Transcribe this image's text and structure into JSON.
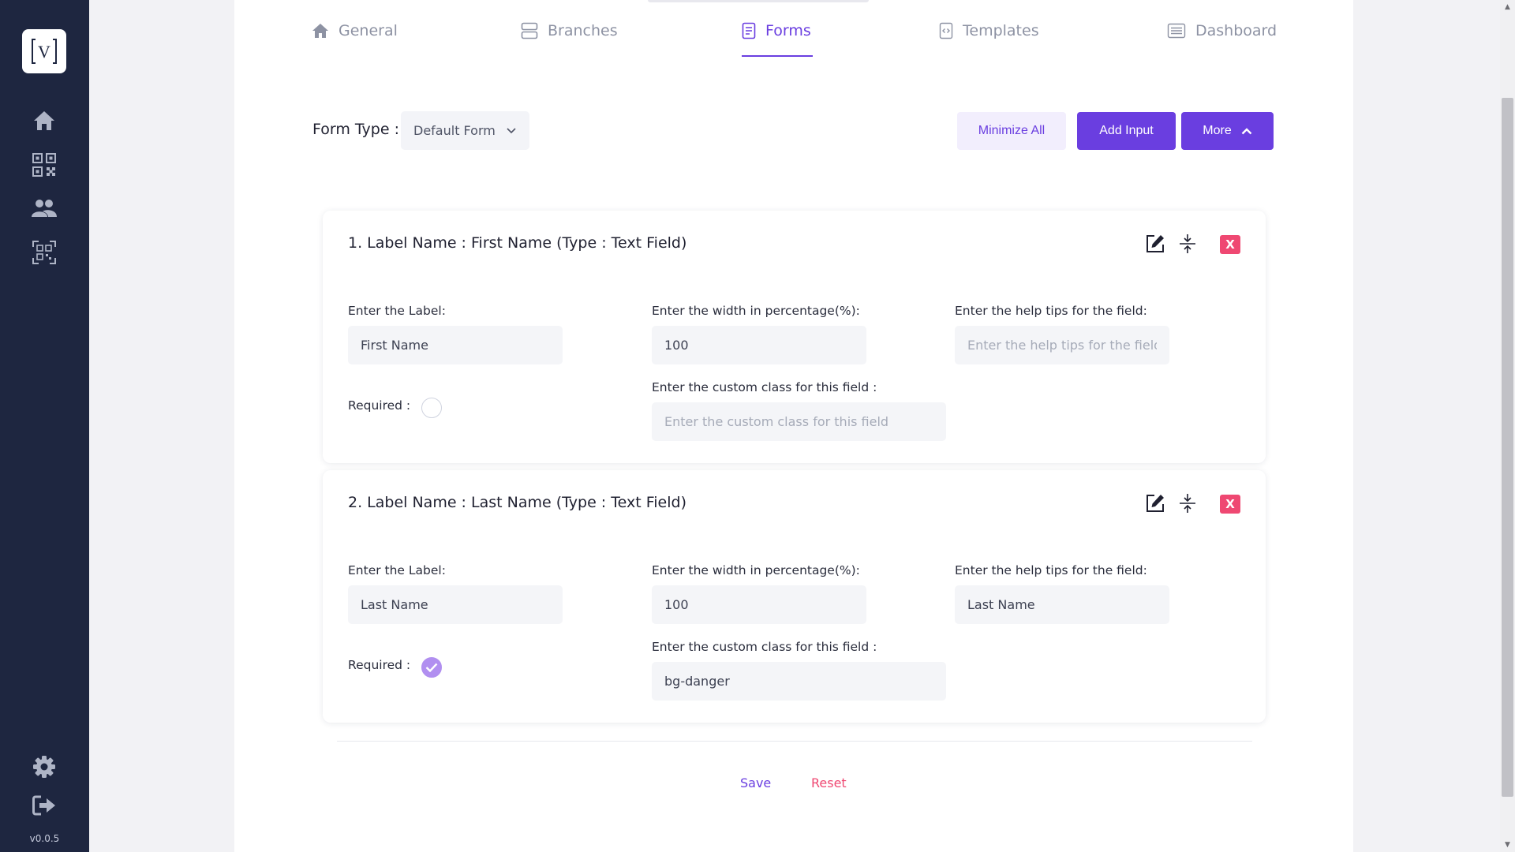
{
  "sidebar": {
    "logo_letter": "V",
    "version": "v0.0.5",
    "items": [
      {
        "name": "home-icon"
      },
      {
        "name": "qr-code-icon"
      },
      {
        "name": "users-icon"
      },
      {
        "name": "qr-scan-icon"
      }
    ],
    "bottom_items": [
      {
        "name": "settings-icon"
      },
      {
        "name": "logout-icon"
      }
    ]
  },
  "tabs": [
    {
      "label": "General",
      "icon": "home-icon",
      "active": false
    },
    {
      "label": "Branches",
      "icon": "branches-icon",
      "active": false
    },
    {
      "label": "Forms",
      "icon": "document-icon",
      "active": true
    },
    {
      "label": "Templates",
      "icon": "code-file-icon",
      "active": false
    },
    {
      "label": "Dashboard",
      "icon": "list-icon",
      "active": false
    }
  ],
  "toolbar": {
    "form_type_label": "Form Type :",
    "form_type_value": "Default Form",
    "minimize_all": "Minimize All",
    "add_input": "Add Input",
    "more": "More"
  },
  "fields": [
    {
      "title": "1. Label Name : First Name (Type : Text Field)",
      "label_caption": "Enter the Label:",
      "label_value": "First Name",
      "width_caption": "Enter the width in percentage(%):",
      "width_value": "100",
      "help_caption": "Enter the help tips for the field:",
      "help_value": "",
      "help_placeholder": "Enter the help tips for the field",
      "required_caption": "Required :",
      "required": false,
      "class_caption": "Enter the custom class for this field :",
      "class_value": "",
      "class_placeholder": "Enter the custom class for this field",
      "close_label": "X"
    },
    {
      "title": "2. Label Name : Last Name (Type : Text Field)",
      "label_caption": "Enter the Label:",
      "label_value": "Last Name",
      "width_caption": "Enter the width in percentage(%):",
      "width_value": "100",
      "help_caption": "Enter the help tips for the field:",
      "help_value": "Last Name",
      "help_placeholder": "Enter the help tips for the field",
      "required_caption": "Required :",
      "required": true,
      "class_caption": "Enter the custom class for this field :",
      "class_value": "bg-danger",
      "class_placeholder": "Enter the custom class for this field",
      "close_label": "X"
    }
  ],
  "actions": {
    "save": "Save",
    "reset": "Reset"
  },
  "colors": {
    "sidebar": "#1e2640",
    "accent": "#6a3ee0",
    "danger": "#ef4872",
    "checked": "#b18ff0"
  }
}
